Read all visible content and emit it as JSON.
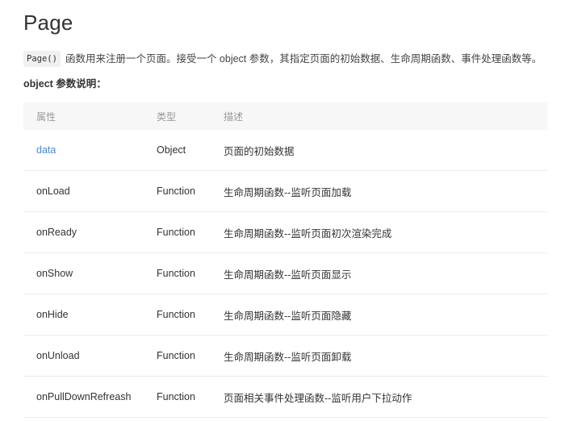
{
  "page": {
    "title": "Page",
    "intro_code": "Page()",
    "intro_text": "函数用来注册一个页面。接受一个 object 参数，其指定页面的初始数据、生命周期函数、事件处理函数等。",
    "section_title": "object 参数说明："
  },
  "table": {
    "headers": {
      "name": "属性",
      "type": "类型",
      "desc": "描述"
    },
    "rows": [
      {
        "name": "data",
        "type": "Object",
        "desc": "页面的初始数据"
      },
      {
        "name": "onLoad",
        "type": "Function",
        "desc": "生命周期函数--监听页面加载"
      },
      {
        "name": "onReady",
        "type": "Function",
        "desc": "生命周期函数--监听页面初次渲染完成"
      },
      {
        "name": "onShow",
        "type": "Function",
        "desc": "生命周期函数--监听页面显示"
      },
      {
        "name": "onHide",
        "type": "Function",
        "desc": "生命周期函数--监听页面隐藏"
      },
      {
        "name": "onUnload",
        "type": "Function",
        "desc": "生命周期函数--监听页面卸载"
      },
      {
        "name": "onPullDownRefreash",
        "type": "Function",
        "desc": "页面相关事件处理函数--监听用户下拉动作"
      }
    ]
  },
  "colors": {
    "link": "#4a8bd1",
    "header_bg": "#f7f7f7",
    "header_text": "#9a9a9a",
    "row_border": "#ececec"
  }
}
